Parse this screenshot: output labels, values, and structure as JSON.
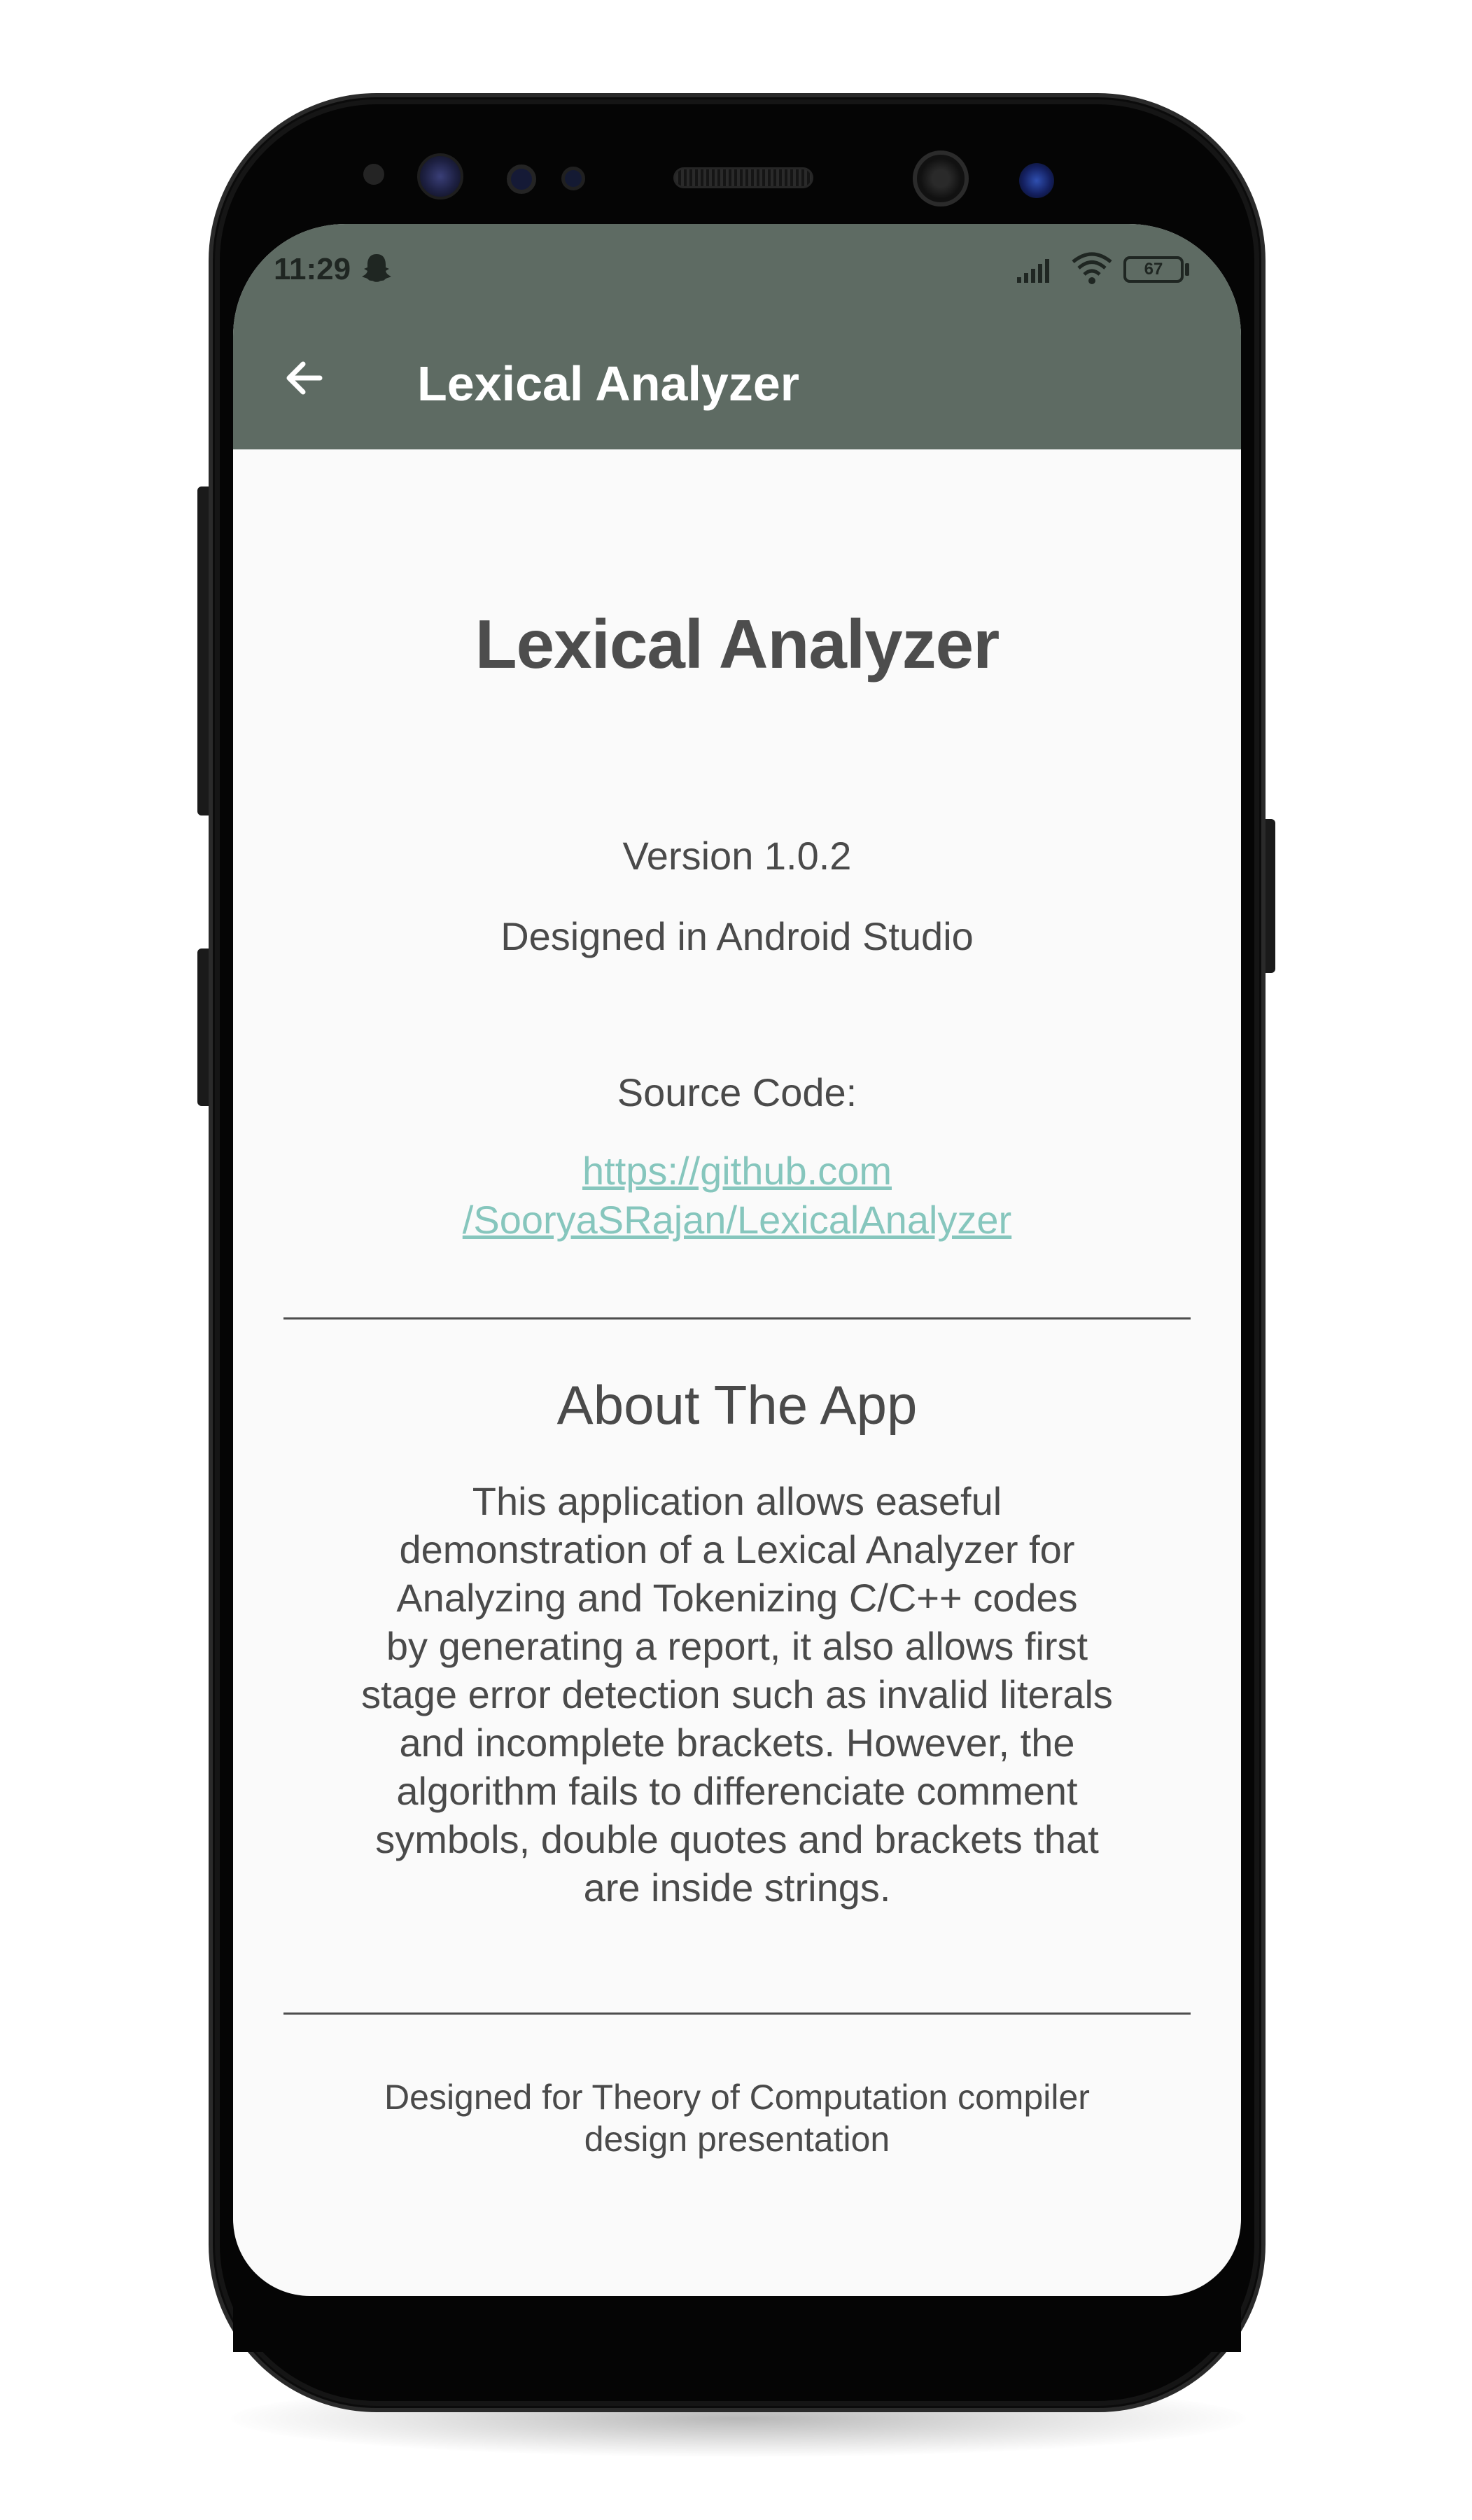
{
  "status_bar": {
    "time": "11:29",
    "battery": "67",
    "icons": [
      "ghost-icon",
      "signal-icon",
      "wifi-icon",
      "battery-icon"
    ]
  },
  "app_bar": {
    "back_icon": "arrow-left-icon",
    "title": "Lexical Analyzer",
    "color": "#5e6b63"
  },
  "main": {
    "title": "Lexical Analyzer",
    "version": "Version 1.0.2",
    "designed_in": "Designed in Android Studio",
    "source_label": "Source Code:",
    "source_link_line1": "https://github.com",
    "source_link_line2": "/SooryaSRajan/LexicalAnalyzer",
    "link_color": "#86c6bd"
  },
  "about": {
    "title": "About The App",
    "lines": [
      "This application allows easeful",
      "demonstration of a Lexical Analyzer for",
      "Analyzing and Tokenizing C/C++ codes",
      "by generating a report, it also allows first",
      "stage error detection such as invalid literals",
      "and incomplete brackets. However, the",
      "algorithm fails to differenciate comment",
      "symbols, double quotes and brackets that",
      "are inside strings."
    ]
  },
  "footer": {
    "line1": "Designed for Theory of Computation compiler",
    "line2": "design presentation"
  }
}
